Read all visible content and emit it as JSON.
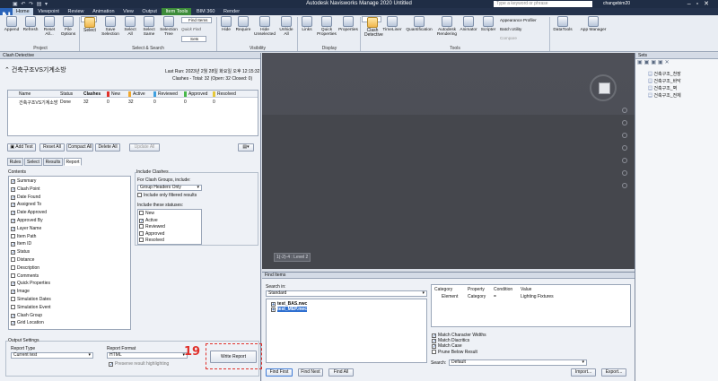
{
  "window": {
    "title": "Autodesk Navisworks Manage 2020    Untitled",
    "search_placeholder": "Type a keyword or phrase",
    "user": "changebim20",
    "app_logo": "N"
  },
  "menu": [
    "Home",
    "Viewpoint",
    "Review",
    "Animation",
    "View",
    "Output",
    "Item Tools",
    "BIM 360",
    "Render"
  ],
  "ribbon": {
    "buttons": [
      {
        "label": "Append",
        "icon": "append-icon"
      },
      {
        "label": "Refresh",
        "icon": "refresh-icon"
      },
      {
        "label": "Reset All...",
        "icon": "reset-icon"
      },
      {
        "label": "File Options",
        "icon": "file-options-icon"
      },
      {
        "label": "Select",
        "icon": "select-icon"
      },
      {
        "label": "Save Selection",
        "icon": "save-selection-icon"
      },
      {
        "label": "Select All",
        "icon": "select-all-icon"
      },
      {
        "label": "Select Same",
        "icon": "select-same-icon"
      },
      {
        "label": "Selection Tree",
        "icon": "selection-tree-icon"
      },
      {
        "label": "Hide",
        "icon": "hide-icon"
      },
      {
        "label": "Require",
        "icon": "require-icon"
      },
      {
        "label": "Hide Unselected",
        "icon": "hide-unselected-icon"
      },
      {
        "label": "Unhide All",
        "icon": "unhide-icon"
      },
      {
        "label": "Links",
        "icon": "links-icon"
      },
      {
        "label": "Quick Properties",
        "icon": "quick-properties-icon"
      },
      {
        "label": "Properties",
        "icon": "properties-icon"
      },
      {
        "label": "Clash Detective",
        "icon": "clash-detective-icon"
      },
      {
        "label": "TimeLiner",
        "icon": "timeliner-icon"
      },
      {
        "label": "Quantification",
        "icon": "quantification-icon"
      },
      {
        "label": "Autodesk Rendering",
        "icon": "rendering-icon"
      },
      {
        "label": "Animator",
        "icon": "animator-icon"
      },
      {
        "label": "Scripter",
        "icon": "scripter-icon"
      },
      {
        "label": "DataTools",
        "icon": "datatools-icon"
      },
      {
        "label": "App Manager",
        "icon": "app-manager-icon"
      }
    ],
    "small": {
      "find_items": "Find Items",
      "quick_find": "Quick Find",
      "sets": "Sets",
      "appearance_profiler": "Appearance Profiler",
      "batch_utility": "Batch Utility",
      "compare": "Compare"
    },
    "groups": {
      "project": "Project",
      "select_search": "Select & Search",
      "visibility": "Visibility",
      "display": "Display",
      "tools": "Tools"
    }
  },
  "clash": {
    "panel_title": "Clash Detective",
    "test_name": "건축구조VS기계소방",
    "last_run": "Last Run:  2023년 2월 28일 화요일 오후 12:15:32",
    "summary": "Clashes - Total: 32  (Open: 32  Closed: 0)",
    "headers": [
      "Name",
      "Status",
      "Clashes",
      "New",
      "Active",
      "Reviewed",
      "Approved",
      "Resolved"
    ],
    "header_colors": [
      "",
      "",
      "",
      "#e0312b",
      "#f1a72b",
      "#3fa0e0",
      "#48b84a",
      "#e6c83a"
    ],
    "row": [
      "건축구조VS기계소방",
      "Done",
      "32",
      "0",
      "32",
      "0",
      "0",
      "0"
    ],
    "buttons": {
      "add_test": "Add Test",
      "reset_all": "Reset All",
      "compact_all": "Compact All",
      "delete_all": "Delete All",
      "update_all": "Update All"
    },
    "tabs": [
      "Rules",
      "Select",
      "Results",
      "Report"
    ],
    "contents_label": "Contents",
    "contents": [
      {
        "label": "Summary",
        "checked": true
      },
      {
        "label": "Clash Point",
        "checked": true
      },
      {
        "label": "Date Found",
        "checked": true
      },
      {
        "label": "Assigned To",
        "checked": true
      },
      {
        "label": "Date Approved",
        "checked": true
      },
      {
        "label": "Approved By",
        "checked": true
      },
      {
        "label": "Layer Name",
        "checked": true
      },
      {
        "label": "Item Path",
        "checked": false
      },
      {
        "label": "Item ID",
        "checked": true
      },
      {
        "label": "Status",
        "checked": true
      },
      {
        "label": "Distance",
        "checked": false
      },
      {
        "label": "Description",
        "checked": false
      },
      {
        "label": "Comments",
        "checked": false
      },
      {
        "label": "Quick Properties",
        "checked": true
      },
      {
        "label": "Image",
        "checked": true
      },
      {
        "label": "Simulation Dates",
        "checked": false
      },
      {
        "label": "Simulation Event",
        "checked": false
      },
      {
        "label": "Clash Group",
        "checked": true
      },
      {
        "label": "Grid Location",
        "checked": true
      }
    ],
    "include_clashes": "Include Clashes",
    "for_clash_groups": "For Clash Groups, include:",
    "group_select": "Group Headers Only",
    "only_filtered": "Include only filtered results",
    "include_statuses": "Include these statuses:",
    "statuses": [
      {
        "label": "New",
        "checked": false
      },
      {
        "label": "Active",
        "checked": true
      },
      {
        "label": "Reviewed",
        "checked": false
      },
      {
        "label": "Approved",
        "checked": false
      },
      {
        "label": "Resolved",
        "checked": false
      }
    ],
    "output_settings": "Output Settings",
    "report_type_label": "Report Type",
    "report_type": "Current test",
    "report_format_label": "Report Format",
    "report_format": "HTML",
    "preserve": "Preserve result highlighting",
    "write_report": "Write Report",
    "annotation": "19"
  },
  "viewport": {
    "level_tag": "1(-2)-4 : Level 2"
  },
  "sets": {
    "title": "Sets",
    "items": [
      "건축구조_천장",
      "건축구조_바닥",
      "건축구조_벽",
      "건축구조_전체"
    ]
  },
  "find": {
    "title": "Find Items",
    "search_in_label": "Search in:",
    "search_in": "Standard",
    "files": [
      "test_BAS.nwc",
      "test_MEP.nwc"
    ],
    "grid_headers": [
      "Category",
      "Property",
      "Condition",
      "Value"
    ],
    "grid_row": [
      "Element",
      "Category",
      "=",
      "Lighting Fixtures"
    ],
    "options": [
      {
        "label": "Match Character Widths",
        "checked": true
      },
      {
        "label": "Match Diacritics",
        "checked": true
      },
      {
        "label": "Match Case",
        "checked": true
      },
      {
        "label": "Prune Below Result",
        "checked": false
      }
    ],
    "search_label": "Search:",
    "search_value": "Default",
    "buttons": {
      "find_first": "Find First",
      "find_next": "Find Next",
      "find_all": "Find All",
      "import": "Import...",
      "export": "Export..."
    }
  }
}
